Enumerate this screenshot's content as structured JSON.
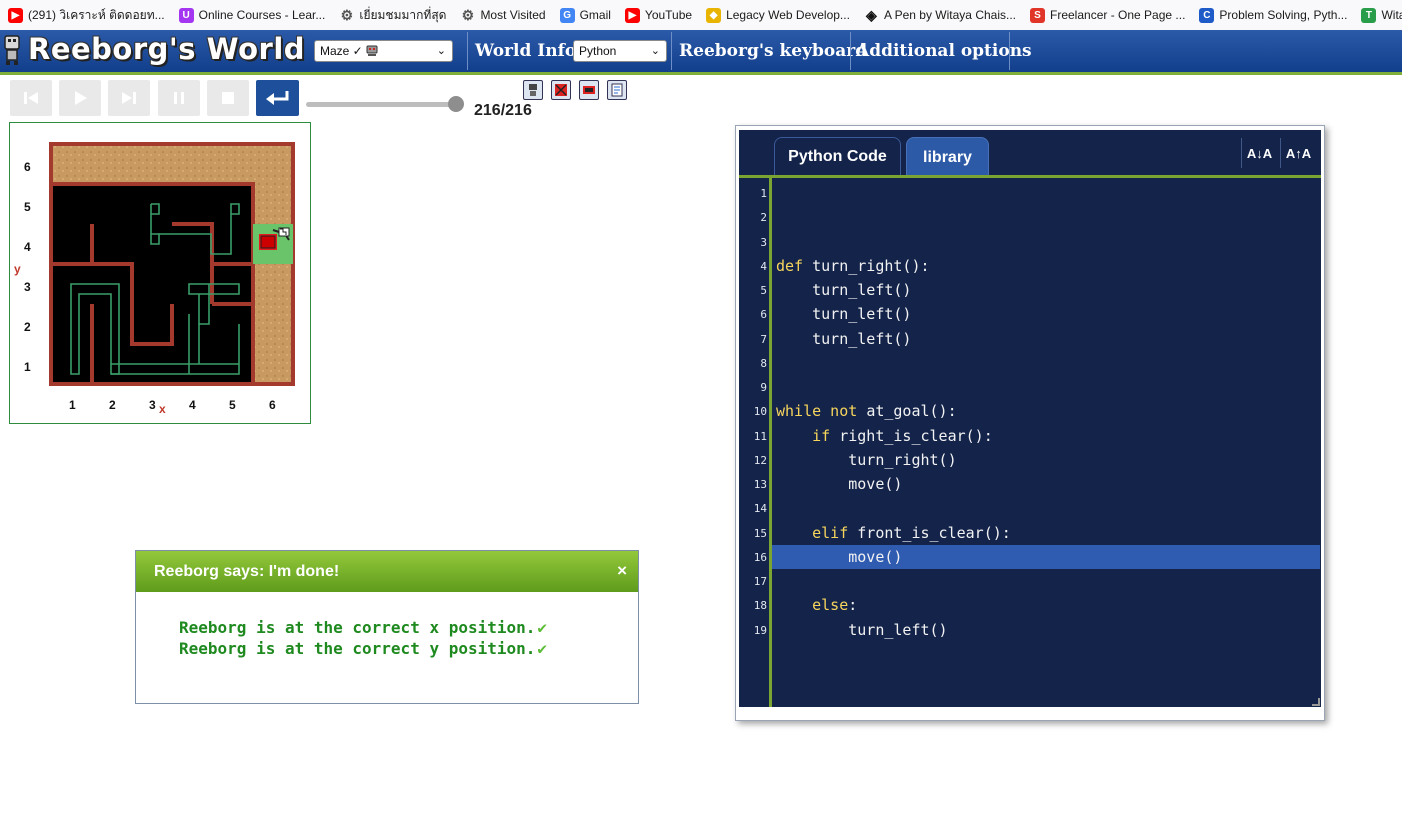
{
  "bookmarks": [
    {
      "label": "(291) วิเคราะห์ ติดดอยท...",
      "icon": "youtube-icon",
      "color": "#ff0000"
    },
    {
      "label": "Online Courses - Lear...",
      "icon": "udemy-icon",
      "color": "#a435f0"
    },
    {
      "label": "เยี่ยมชมมากที่สุด",
      "icon": "gear-icon",
      "color": "#555555"
    },
    {
      "label": "Most Visited",
      "icon": "gear-icon",
      "color": "#555555"
    },
    {
      "label": "Gmail",
      "icon": "google-icon",
      "color": "#4285f4"
    },
    {
      "label": "YouTube",
      "icon": "youtube-icon",
      "color": "#ff0000"
    },
    {
      "label": "Legacy Web Develop...",
      "icon": "fcc-icon",
      "color": "#e8b400"
    },
    {
      "label": "A Pen by Witaya Chais...",
      "icon": "codepen-icon",
      "color": "#111111"
    },
    {
      "label": "Freelancer - One Page ...",
      "icon": "s-icon",
      "color": "#e1352a"
    },
    {
      "label": "Problem Solving, Pyth...",
      "icon": "c-icon",
      "color": "#1e5ac8"
    },
    {
      "label": "Witaya_Cha",
      "icon": "t-icon",
      "color": "#2a9d4a"
    }
  ],
  "app": {
    "title": "Reeborg's World",
    "world_select": "Maze ✓",
    "language_select": "Python",
    "menu": {
      "world_info": "World Info",
      "keyboard": "Reeborg's keyboard",
      "options": "Additional options"
    }
  },
  "controls": {
    "step_counter": "216/216",
    "slider_fraction": 1.0
  },
  "world": {
    "y_axis_label": "y",
    "x_axis_label": "x",
    "y_ticks": [
      "6",
      "5",
      "4",
      "3",
      "2",
      "1"
    ],
    "x_ticks": [
      "1",
      "2",
      "3",
      "4",
      "5",
      "6"
    ]
  },
  "dialog": {
    "title": "Reeborg says: I'm done!",
    "close": "×",
    "lines": [
      "Reeborg is at the correct x position.",
      "Reeborg is at the correct y position."
    ],
    "check": "✔"
  },
  "editor": {
    "tabs": {
      "python": "Python Code",
      "library": "library"
    },
    "font_smaller": "A↓A",
    "font_larger": "A↑A",
    "highlighted_line": 16,
    "lines": [
      {
        "n": "1",
        "text": ""
      },
      {
        "n": "2",
        "text": ""
      },
      {
        "n": "3",
        "text": ""
      },
      {
        "n": "4",
        "kw": "def",
        "text": "turn_right():"
      },
      {
        "n": "5",
        "text": "    turn_left()"
      },
      {
        "n": "6",
        "text": "    turn_left()"
      },
      {
        "n": "7",
        "text": "    turn_left()"
      },
      {
        "n": "8",
        "text": ""
      },
      {
        "n": "9",
        "text": ""
      },
      {
        "n": "10",
        "kw": "while not",
        "text": "at_goal():"
      },
      {
        "n": "11",
        "indent": "    ",
        "kw": "if",
        "text": "right_is_clear():"
      },
      {
        "n": "12",
        "text": "        turn_right()"
      },
      {
        "n": "13",
        "text": "        move()"
      },
      {
        "n": "14",
        "text": ""
      },
      {
        "n": "15",
        "indent": "    ",
        "kw": "elif",
        "text": "front_is_clear():"
      },
      {
        "n": "16",
        "text": "        move()"
      },
      {
        "n": "17",
        "text": ""
      },
      {
        "n": "18",
        "indent": "    ",
        "kw": "else",
        "text": ":",
        "nospace": true
      },
      {
        "n": "19",
        "text": "        turn_left()"
      }
    ]
  }
}
